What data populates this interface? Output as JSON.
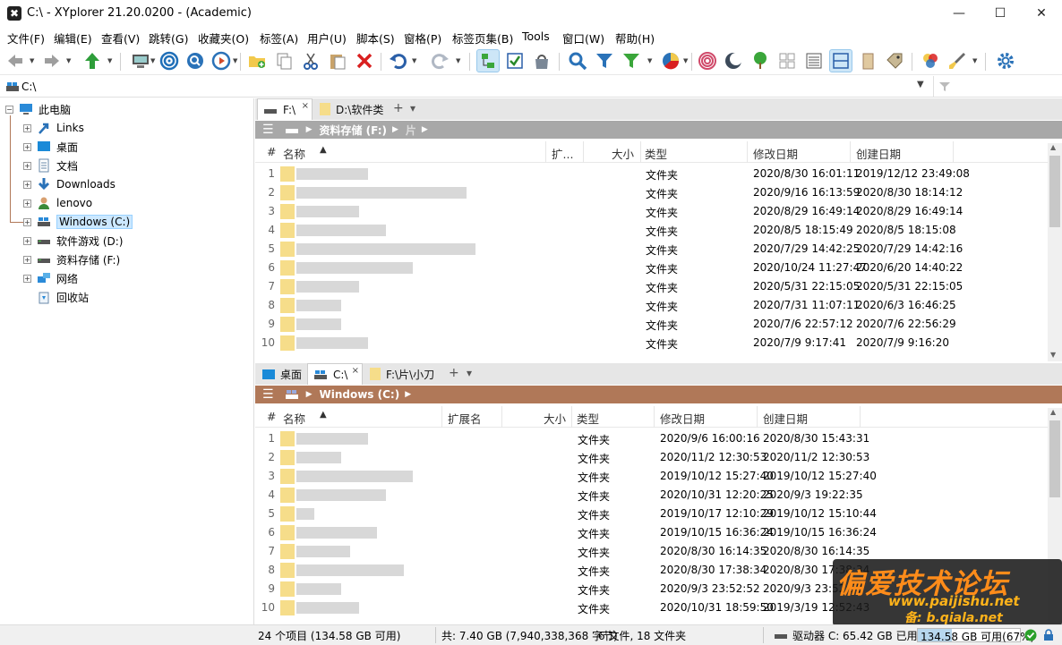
{
  "window": {
    "title": "C:\\ - XYplorer 21.20.0200 - (Academic)",
    "minimize": "—",
    "maximize": "☐",
    "close": "✕"
  },
  "menu": [
    "文件(F)",
    "编辑(E)",
    "查看(V)",
    "跳转(G)",
    "收藏夹(O)",
    "标签(A)",
    "用户(U)",
    "脚本(S)",
    "窗格(P)",
    "标签页集(B)",
    "Tools",
    "窗口(W)",
    "帮助(H)"
  ],
  "toolbar": {
    "icons": [
      "back-icon",
      "forward-icon",
      "up-icon",
      "computer-icon",
      "target-icon",
      "search-circle-icon",
      "play-circle-icon",
      "new-folder-icon",
      "copy-icon",
      "cut-icon",
      "paste-icon",
      "delete-icon",
      "undo-icon",
      "redo-icon",
      "tree-icon",
      "checkbox-icon",
      "bag-icon",
      "find-icon",
      "filter-icon",
      "filter-green-icon",
      "pie-icon",
      "spiral-icon",
      "moon-icon",
      "tree-green-icon",
      "grid-icon",
      "details-icon",
      "dual-pane-icon",
      "book-icon",
      "tag-icon",
      "colors-icon",
      "brush-icon",
      "settings-icon"
    ]
  },
  "address": {
    "value": "C:\\"
  },
  "tree": {
    "root": "此电脑",
    "items": [
      "Links",
      "桌面",
      "文档",
      "Downloads",
      "lenovo",
      "Windows (C:)",
      "软件游戏 (D:)",
      "资料存储 (F:)",
      "网络",
      "回收站"
    ]
  },
  "pane_top": {
    "tabs": [
      "F:\\",
      "D:\\软件类"
    ],
    "add_tab": "+",
    "dropdown": "▾",
    "breadcrumb": [
      "资料存储 (F:)",
      "片"
    ],
    "columns": [
      "#",
      "名称",
      "扩...",
      "大小",
      "类型",
      "修改日期",
      "创建日期"
    ],
    "rows": [
      {
        "n": "1",
        "type": "文件夹",
        "modified": "2020/8/30 16:01:11",
        "created": "2019/12/12 23:49:08"
      },
      {
        "n": "2",
        "type": "文件夹",
        "modified": "2020/9/16 16:13:59",
        "created": "2020/8/30 18:14:12"
      },
      {
        "n": "3",
        "type": "文件夹",
        "modified": "2020/8/29 16:49:14",
        "created": "2020/8/29 16:49:14"
      },
      {
        "n": "4",
        "type": "文件夹",
        "modified": "2020/8/5 18:15:49",
        "created": "2020/8/5 18:15:08"
      },
      {
        "n": "5",
        "type": "文件夹",
        "modified": "2020/7/29 14:42:25",
        "created": "2020/7/29 14:42:16"
      },
      {
        "n": "6",
        "type": "文件夹",
        "modified": "2020/10/24 11:27:47",
        "created": "2020/6/20 14:40:22"
      },
      {
        "n": "7",
        "type": "文件夹",
        "modified": "2020/5/31 22:15:05",
        "created": "2020/5/31 22:15:05"
      },
      {
        "n": "8",
        "type": "文件夹",
        "modified": "2020/7/31 11:07:11",
        "created": "2020/6/3 16:46:25"
      },
      {
        "n": "9",
        "type": "文件夹",
        "modified": "2020/7/6 22:57:12",
        "created": "2020/7/6 22:56:29"
      },
      {
        "n": "10",
        "type": "文件夹",
        "modified": "2020/7/9 9:17:41",
        "created": "2020/7/9 9:16:20"
      }
    ]
  },
  "pane_bottom": {
    "tabs": [
      "桌面",
      "C:\\",
      "F:\\片\\小刀"
    ],
    "add_tab": "+",
    "dropdown": "▾",
    "breadcrumb": [
      "Windows (C:)"
    ],
    "columns": [
      "#",
      "名称",
      "扩展名",
      "大小",
      "类型",
      "修改日期",
      "创建日期"
    ],
    "rows": [
      {
        "n": "1",
        "type": "文件夹",
        "modified": "2020/9/6 16:00:16",
        "created": "2020/8/30 15:43:31"
      },
      {
        "n": "2",
        "type": "文件夹",
        "modified": "2020/11/2 12:30:53",
        "created": "2020/11/2 12:30:53"
      },
      {
        "n": "3",
        "type": "文件夹",
        "modified": "2019/10/12 15:27:40",
        "created": "2019/10/12 15:27:40"
      },
      {
        "n": "4",
        "type": "文件夹",
        "modified": "2020/10/31 12:20:25",
        "created": "2020/9/3 19:22:35"
      },
      {
        "n": "5",
        "type": "文件夹",
        "modified": "2019/10/17 12:10:29",
        "created": "2019/10/12 15:10:44"
      },
      {
        "n": "6",
        "type": "文件夹",
        "modified": "2019/10/15 16:36:24",
        "created": "2019/10/15 16:36:24"
      },
      {
        "n": "7",
        "type": "文件夹",
        "modified": "2020/8/30 16:14:35",
        "created": "2020/8/30 16:14:35"
      },
      {
        "n": "8",
        "type": "文件夹",
        "modified": "2020/8/30 17:38:34",
        "created": "2020/8/30 17:38:34"
      },
      {
        "n": "9",
        "type": "文件夹",
        "modified": "2020/9/3 23:52:52",
        "created": "2020/9/3 23:52:52"
      },
      {
        "n": "10",
        "type": "文件夹",
        "modified": "2020/10/31 18:59:50",
        "created": "2019/3/19 12:52:43"
      }
    ]
  },
  "status": {
    "items": "24 个项目 (134.58 GB 可用)",
    "total": "共: 7.40 GB (7,940,338,368 字节)",
    "counts": "6 文件, 18 文件夹",
    "drive": "驱动器 C: 65.42 GB 已用",
    "free": "134.58 GB 可用(67%)",
    "used_fraction": 0.33
  },
  "watermark": {
    "line1": "偏爱技术论坛",
    "line2": "www.paijishu.net",
    "line3": "备: b.qiala.net"
  },
  "colors": {
    "breadcrumb_top": "#a8a8a8",
    "breadcrumb_bottom": "#b07858",
    "accent": "#0078d7"
  }
}
